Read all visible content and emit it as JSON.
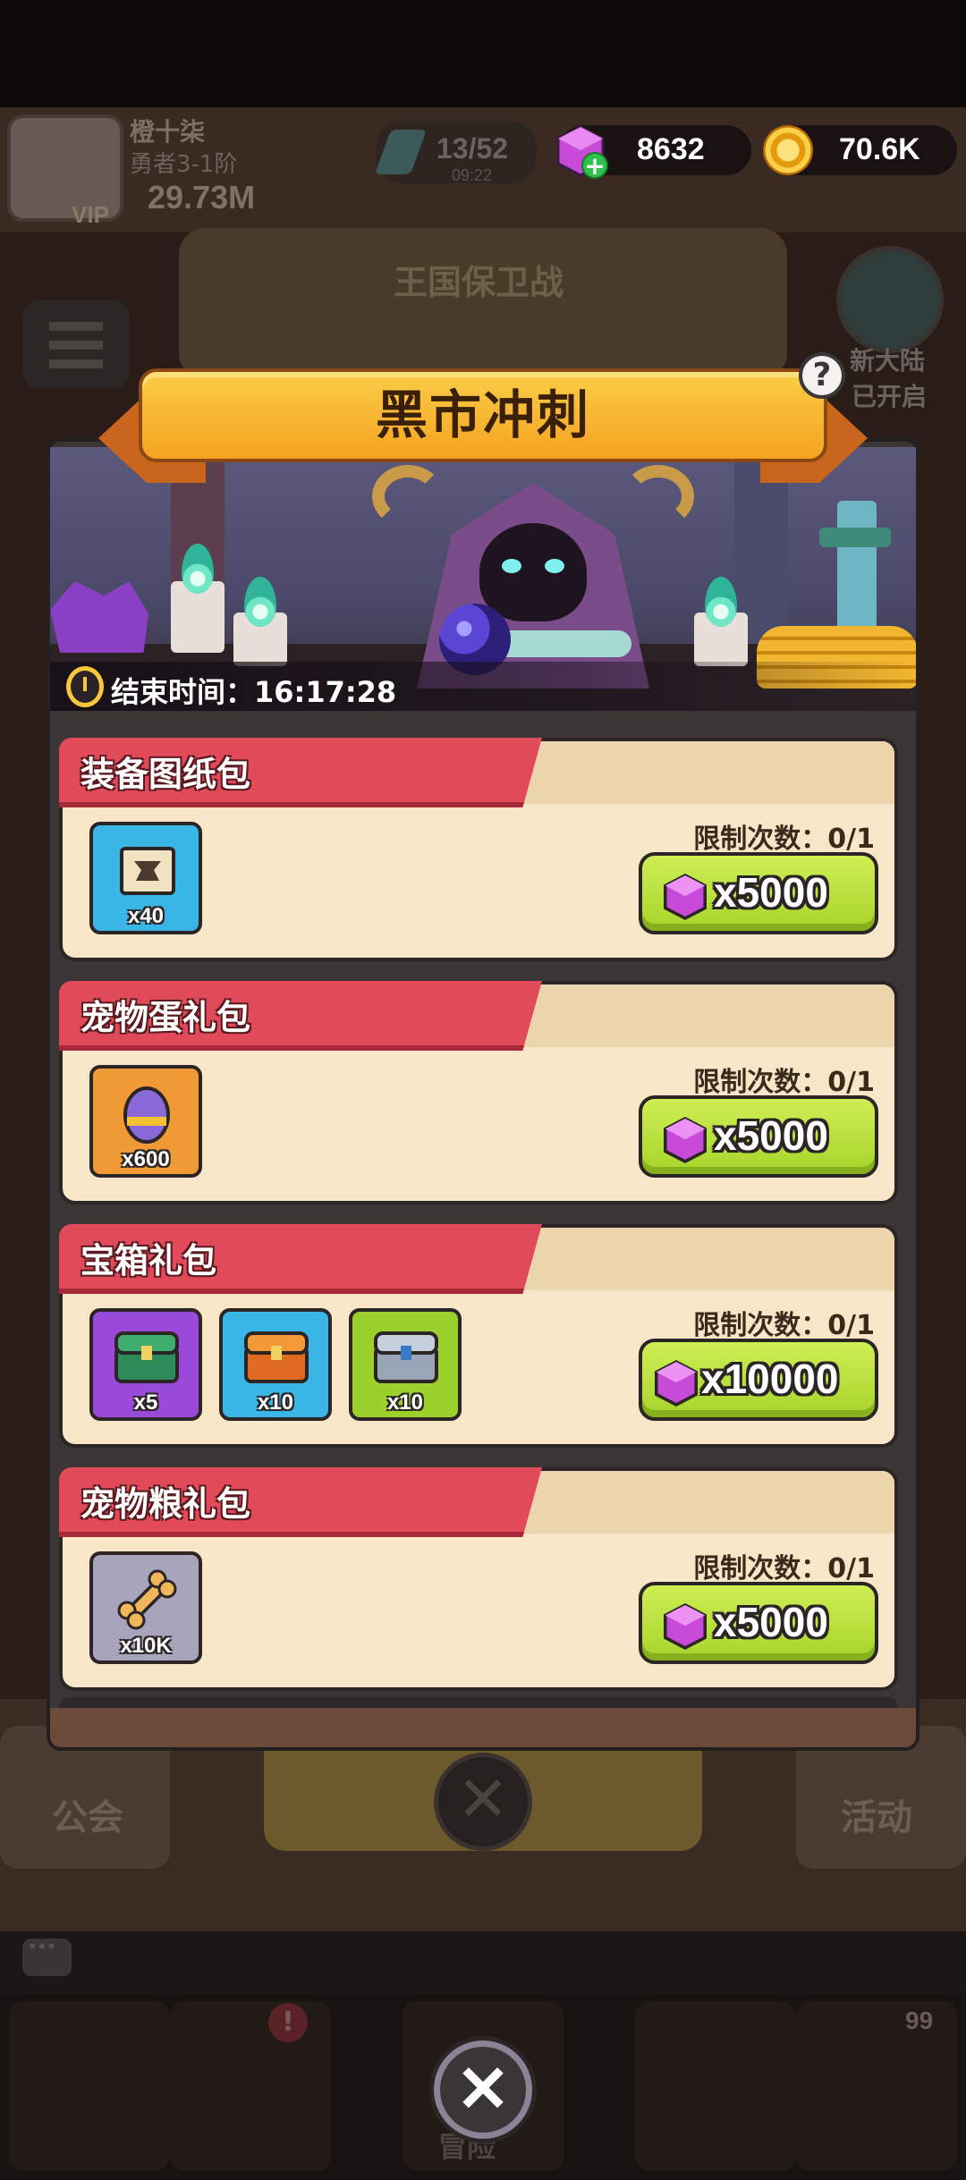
{
  "background": {
    "player_name": "橙十柒",
    "player_rank": "勇者3-1阶",
    "vip_label": "VIP",
    "power": "29.73M",
    "energy": "13/52",
    "energy_timer": "09:22",
    "kingdom_title": "王国保卫战",
    "new_land_line1": "新大陆",
    "new_land_line2": "已开启",
    "guild_label": "公会",
    "event_label": "活动",
    "adventure_label": "冒险",
    "nav_badge": "!",
    "nav_count": "99"
  },
  "currency": {
    "gems": "8632",
    "gems_plus": "+",
    "coins": "70.6K"
  },
  "popup": {
    "title": "黑市冲刺",
    "help_symbol": "?",
    "end_time_label": "结束时间：16:17:28"
  },
  "packs": [
    {
      "title": "装备图纸包",
      "limit": "限制次数：0/1",
      "price": "x5000",
      "items": [
        {
          "icon": "blueprint-icon",
          "qty": "x40"
        }
      ]
    },
    {
      "title": "宠物蛋礼包",
      "limit": "限制次数：0/1",
      "price": "x5000",
      "items": [
        {
          "icon": "pet-egg-icon",
          "qty": "x600"
        }
      ]
    },
    {
      "title": "宝箱礼包",
      "limit": "限制次数：0/1",
      "price": "x10000",
      "items": [
        {
          "icon": "green-chest-icon",
          "qty": "x5"
        },
        {
          "icon": "orange-chest-icon",
          "qty": "x10"
        },
        {
          "icon": "silver-chest-icon",
          "qty": "x10"
        }
      ]
    },
    {
      "title": "宠物粮礼包",
      "limit": "限制次数：0/1",
      "price": "x5000",
      "items": [
        {
          "icon": "bone-icon",
          "qty": "x10K"
        }
      ]
    }
  ],
  "close_symbol": "✕",
  "colors": {
    "title_banner": "#f4a321",
    "card_tab": "#e04a59",
    "buy_button": "#a6d42a",
    "gem": "#c84ad8"
  }
}
